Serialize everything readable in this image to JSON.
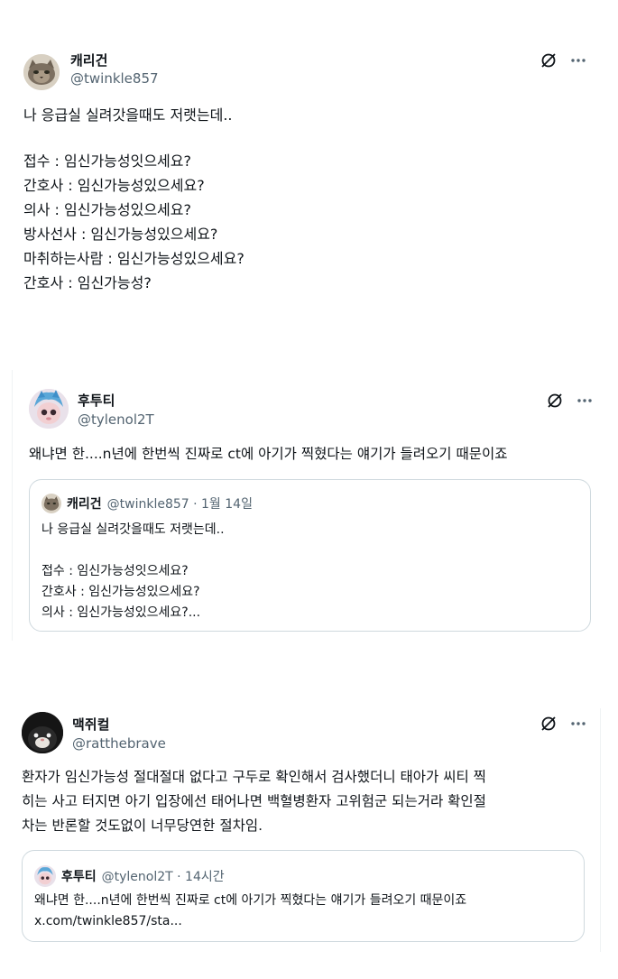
{
  "posts": [
    {
      "display_name": "캐리건",
      "handle": "@twinkle857",
      "lines": [
        "나 응급실 실려갓을때도 저랫는데..",
        "",
        "접수 : 임신가능성잇으세요?",
        "간호사 : 임신가능성있으세요?",
        "의사 : 임신가능성있으세요?",
        "방사선사 : 임신가능성있으세요?",
        "마취하는사람 : 임신가능성있으세요?",
        "간호사 : 임신가능성?"
      ]
    },
    {
      "display_name": "후투티",
      "handle": "@tylenol2T",
      "lines": [
        "왜냐면 한....n년에 한번씩 진짜로 ct에 아기가 찍혔다는 얘기가 들려오기 때문이죠"
      ],
      "quote": {
        "display_name": "캐리건",
        "meta": "@twinkle857 · 1월 14일",
        "lines": [
          "나 응급실 실려갓을때도 저랫는데..",
          "",
          "접수 : 임신가능성잇으세요?",
          "간호사 : 임신가능성있으세요?",
          "의사 : 임신가능성있으세요?..."
        ]
      }
    },
    {
      "display_name": "맥쥐컬",
      "handle": "@ratthebrave",
      "lines": [
        "환자가 임신가능성 절대절대 없다고 구두로 확인해서 검사했더니 태아가 씨티 찍",
        "히는 사고 터지면 아기 입장에선 태어나면 백혈병환자 고위험군 되는거라 확인절",
        "차는 반론할 것도없이 너무당연한 절차임."
      ],
      "quote": {
        "display_name": "후투티",
        "meta": "@tylenol2T · 14시간",
        "lines": [
          "왜냐면 한....n년에 한번씩 진짜로 ct에 아기가 찍혔다는 얘기가 들려오기 때문이죠",
          "x.com/twinkle857/sta..."
        ]
      }
    }
  ],
  "icons": [
    "grok-icon",
    "more-icon"
  ]
}
